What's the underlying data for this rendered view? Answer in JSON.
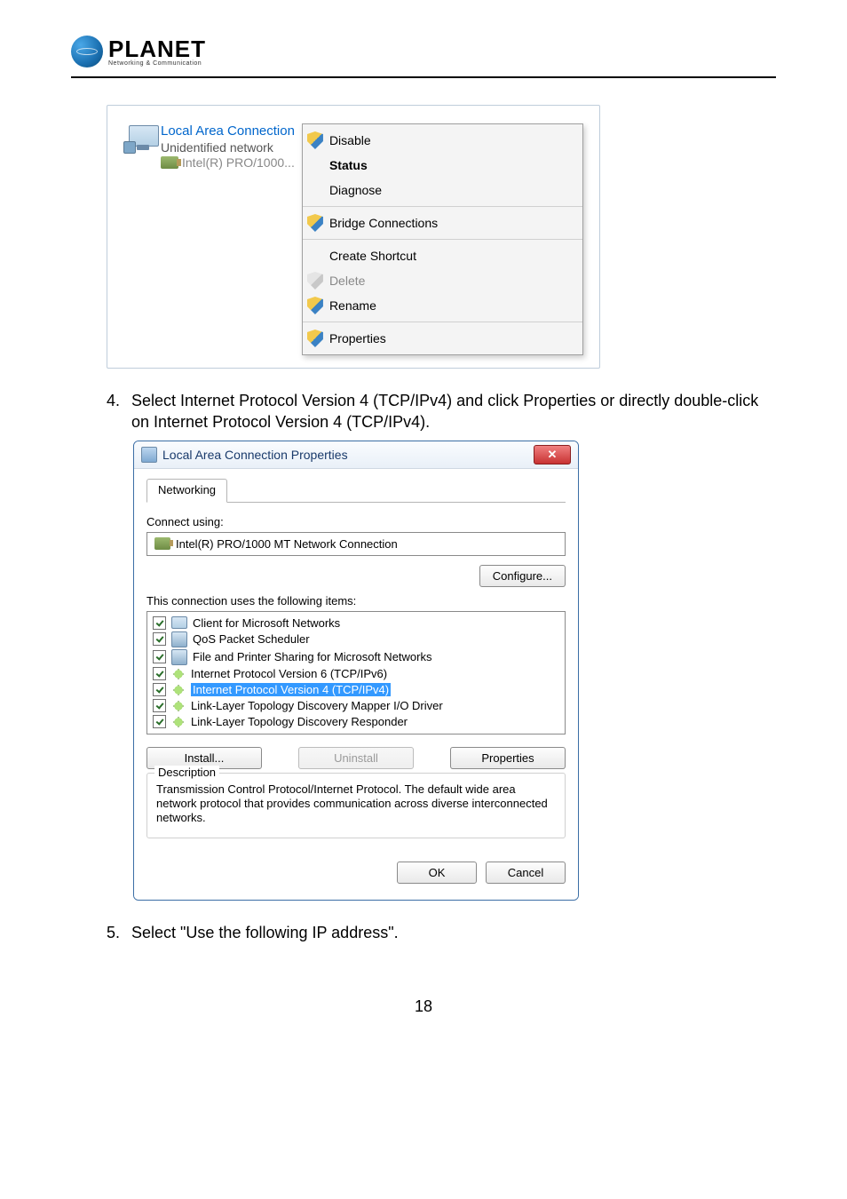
{
  "logo": {
    "title": "PLANET",
    "subtitle": "Networking & Communication"
  },
  "screenshot1": {
    "connection": {
      "name": "Local Area Connection",
      "status": "Unidentified network",
      "adapter": "Intel(R) PRO/1000..."
    },
    "context_menu": {
      "disable": "Disable",
      "status": "Status",
      "diagnose": "Diagnose",
      "bridge": "Bridge Connections",
      "create_shortcut": "Create Shortcut",
      "delete": "Delete",
      "rename": "Rename",
      "properties": "Properties"
    }
  },
  "step4": {
    "num": "4.",
    "text": "Select Internet Protocol Version 4 (TCP/IPv4) and click Properties or directly double-click on Internet Protocol Version 4 (TCP/IPv4)."
  },
  "dialog": {
    "title": "Local Area Connection Properties",
    "tab": "Networking",
    "connect_using_label": "Connect using:",
    "adapter": "Intel(R) PRO/1000 MT Network Connection",
    "configure_btn": "Configure...",
    "items_label": "This connection uses the following items:",
    "items": [
      "Client for Microsoft Networks",
      "QoS Packet Scheduler",
      "File and Printer Sharing for Microsoft Networks",
      "Internet Protocol Version 6 (TCP/IPv6)",
      "Internet Protocol Version 4 (TCP/IPv4)",
      "Link-Layer Topology Discovery Mapper I/O Driver",
      "Link-Layer Topology Discovery Responder"
    ],
    "install_btn": "Install...",
    "uninstall_btn": "Uninstall",
    "properties_btn": "Properties",
    "description_label": "Description",
    "description_text": "Transmission Control Protocol/Internet Protocol. The default wide area network protocol that provides communication across diverse interconnected networks.",
    "ok_btn": "OK",
    "cancel_btn": "Cancel"
  },
  "step5": {
    "num": "5.",
    "text": "Select \"Use the following IP address\"."
  },
  "page_number": "18"
}
